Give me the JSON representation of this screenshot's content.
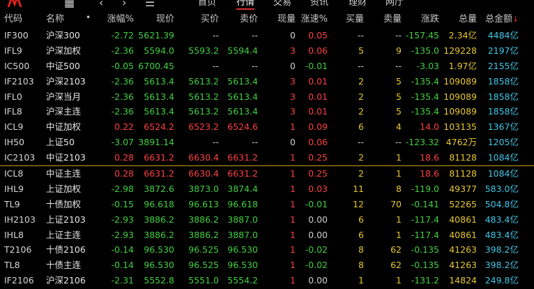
{
  "nav": {
    "items": [
      "首页",
      "行情",
      "交易",
      "资讯",
      "理财",
      "网厅"
    ],
    "active_index": 1
  },
  "headers": [
    "代码",
    "名称",
    "涨幅%",
    "现价",
    "买价",
    "卖价",
    "现量",
    "涨速%",
    "买量",
    "卖量",
    "涨跌",
    "总量",
    "总金额"
  ],
  "header_dot": "•",
  "sort_arrow": "↓",
  "colors": {
    "up": "#ff4040",
    "down": "#40d040",
    "neutral": "#d0d0d0",
    "volume": "#e8c830",
    "amount": "#40c8e8",
    "separator": "#c8a000"
  },
  "rows": [
    {
      "code": "IF300",
      "name": "沪深300",
      "chg": "-2.72",
      "price": "5621.39",
      "bid": "--",
      "ask": "--",
      "cur": "0",
      "spd": "0.05",
      "bv": "--",
      "av": "--",
      "diff": "-157.45",
      "vol": "2.34亿",
      "amt": "4484亿",
      "dir": "down",
      "cur_dir": "neutral",
      "spd_dir": "up",
      "price_dir": "down",
      "bid_dir": "neutral",
      "ask_dir": "neutral"
    },
    {
      "code": "IFL9",
      "name": "沪深加权",
      "chg": "-2.36",
      "price": "5594.0",
      "bid": "5593.2",
      "ask": "5594.4",
      "cur": "3",
      "spd": "0.06",
      "bv": "5",
      "av": "9",
      "diff": "-135.0",
      "vol": "129228",
      "amt": "2197亿",
      "dir": "down",
      "cur_dir": "up",
      "spd_dir": "up",
      "price_dir": "down",
      "bid_dir": "down",
      "ask_dir": "down"
    },
    {
      "code": "IC500",
      "name": "中证500",
      "chg": "-0.05",
      "price": "6700.45",
      "bid": "--",
      "ask": "--",
      "cur": "0",
      "spd": "-0.01",
      "bv": "--",
      "av": "--",
      "diff": "-3.03",
      "vol": "1.97亿",
      "amt": "2155亿",
      "dir": "down",
      "cur_dir": "neutral",
      "spd_dir": "down",
      "price_dir": "down",
      "bid_dir": "neutral",
      "ask_dir": "neutral"
    },
    {
      "code": "IF2103",
      "name": "沪深2103",
      "chg": "-2.36",
      "price": "5613.4",
      "bid": "5613.2",
      "ask": "5613.4",
      "cur": "3",
      "spd": "0.01",
      "bv": "2",
      "av": "5",
      "diff": "-135.4",
      "vol": "109089",
      "amt": "1858亿",
      "dir": "down",
      "cur_dir": "up",
      "spd_dir": "up",
      "price_dir": "down",
      "bid_dir": "down",
      "ask_dir": "down"
    },
    {
      "code": "IFL0",
      "name": "沪深当月",
      "chg": "-2.36",
      "price": "5613.4",
      "bid": "5613.2",
      "ask": "5613.4",
      "cur": "3",
      "spd": "0.01",
      "bv": "2",
      "av": "5",
      "diff": "-135.4",
      "vol": "109089",
      "amt": "1858亿",
      "dir": "down",
      "cur_dir": "up",
      "spd_dir": "up",
      "price_dir": "down",
      "bid_dir": "down",
      "ask_dir": "down"
    },
    {
      "code": "IFL8",
      "name": "沪深主连",
      "chg": "-2.36",
      "price": "5613.4",
      "bid": "5613.2",
      "ask": "5613.4",
      "cur": "3",
      "spd": "0.01",
      "bv": "2",
      "av": "5",
      "diff": "-135.4",
      "vol": "109089",
      "amt": "1858亿",
      "dir": "down",
      "cur_dir": "up",
      "spd_dir": "up",
      "price_dir": "down",
      "bid_dir": "down",
      "ask_dir": "down"
    },
    {
      "code": "ICL9",
      "name": "中证加权",
      "chg": "0.22",
      "price": "6524.2",
      "bid": "6523.2",
      "ask": "6524.6",
      "cur": "1",
      "spd": "0.09",
      "bv": "6",
      "av": "4",
      "diff": "14.0",
      "vol": "103135",
      "amt": "1367亿",
      "dir": "up",
      "cur_dir": "up",
      "spd_dir": "up",
      "price_dir": "up",
      "bid_dir": "up",
      "ask_dir": "up"
    },
    {
      "code": "IH50",
      "name": "上证50",
      "chg": "-3.07",
      "price": "3891.14",
      "bid": "--",
      "ask": "--",
      "cur": "0",
      "spd": "0.06",
      "bv": "--",
      "av": "--",
      "diff": "-123.32",
      "vol": "4762万",
      "amt": "1205亿",
      "dir": "down",
      "cur_dir": "neutral",
      "spd_dir": "up",
      "price_dir": "down",
      "bid_dir": "neutral",
      "ask_dir": "neutral"
    },
    {
      "code": "IC2103",
      "name": "中证2103",
      "chg": "0.28",
      "price": "6631.2",
      "bid": "6630.4",
      "ask": "6631.2",
      "cur": "1",
      "spd": "0.25",
      "bv": "2",
      "av": "1",
      "diff": "18.6",
      "vol": "81128",
      "amt": "1084亿",
      "dir": "up",
      "cur_dir": "up",
      "spd_dir": "up",
      "price_dir": "up",
      "bid_dir": "up",
      "ask_dir": "up"
    },
    {
      "code": "ICL8",
      "name": "中证主连",
      "chg": "0.28",
      "price": "6631.2",
      "bid": "6630.4",
      "ask": "6631.2",
      "cur": "1",
      "spd": "0.25",
      "bv": "2",
      "av": "1",
      "diff": "18.6",
      "vol": "81128",
      "amt": "1084亿",
      "dir": "up",
      "cur_dir": "up",
      "spd_dir": "up",
      "price_dir": "up",
      "bid_dir": "up",
      "ask_dir": "up"
    },
    {
      "code": "IHL9",
      "name": "上证加权",
      "chg": "-2.98",
      "price": "3872.6",
      "bid": "3873.0",
      "ask": "3874.4",
      "cur": "1",
      "spd": "0.03",
      "bv": "11",
      "av": "8",
      "diff": "-119.0",
      "vol": "49377",
      "amt": "583.0亿",
      "dir": "down",
      "cur_dir": "up",
      "spd_dir": "up",
      "price_dir": "down",
      "bid_dir": "down",
      "ask_dir": "down"
    },
    {
      "code": "TL9",
      "name": "十债加权",
      "chg": "-0.15",
      "price": "96.618",
      "bid": "96.613",
      "ask": "96.618",
      "cur": "1",
      "spd": "-0.01",
      "bv": "12",
      "av": "70",
      "diff": "-0.141",
      "vol": "52265",
      "amt": "504.8亿",
      "dir": "down",
      "cur_dir": "up",
      "spd_dir": "down",
      "price_dir": "down",
      "bid_dir": "down",
      "ask_dir": "down"
    },
    {
      "code": "IH2103",
      "name": "上证2103",
      "chg": "-2.93",
      "price": "3886.2",
      "bid": "3886.2",
      "ask": "3887.0",
      "cur": "1",
      "spd": "0.00",
      "bv": "6",
      "av": "1",
      "diff": "-117.4",
      "vol": "40861",
      "amt": "483.4亿",
      "dir": "down",
      "cur_dir": "up",
      "spd_dir": "neutral",
      "price_dir": "down",
      "bid_dir": "down",
      "ask_dir": "down"
    },
    {
      "code": "IHL8",
      "name": "上证主连",
      "chg": "-2.93",
      "price": "3886.2",
      "bid": "3886.2",
      "ask": "3887.0",
      "cur": "1",
      "spd": "0.00",
      "bv": "6",
      "av": "1",
      "diff": "-117.4",
      "vol": "40861",
      "amt": "483.4亿",
      "dir": "down",
      "cur_dir": "up",
      "spd_dir": "neutral",
      "price_dir": "down",
      "bid_dir": "down",
      "ask_dir": "down"
    },
    {
      "code": "T2106",
      "name": "十债2106",
      "chg": "-0.14",
      "price": "96.530",
      "bid": "96.525",
      "ask": "96.530",
      "cur": "1",
      "spd": "-0.02",
      "bv": "8",
      "av": "62",
      "diff": "-0.135",
      "vol": "41263",
      "amt": "398.2亿",
      "dir": "down",
      "cur_dir": "up",
      "spd_dir": "down",
      "price_dir": "down",
      "bid_dir": "down",
      "ask_dir": "down"
    },
    {
      "code": "TL8",
      "name": "十债主连",
      "chg": "-0.14",
      "price": "96.530",
      "bid": "96.525",
      "ask": "96.530",
      "cur": "1",
      "spd": "-0.02",
      "bv": "8",
      "av": "62",
      "diff": "-0.135",
      "vol": "41263",
      "amt": "398.2亿",
      "dir": "down",
      "cur_dir": "up",
      "spd_dir": "down",
      "price_dir": "down",
      "bid_dir": "down",
      "ask_dir": "down"
    },
    {
      "code": "IF2106",
      "name": "沪深2106",
      "chg": "-2.31",
      "price": "5552.8",
      "bid": "5551.0",
      "ask": "5554.2",
      "cur": "1",
      "spd": "0.00",
      "bv": "1",
      "av": "1",
      "diff": "-131.2",
      "vol": "14824",
      "amt": "249.8亿",
      "dir": "down",
      "cur_dir": "up",
      "spd_dir": "neutral",
      "price_dir": "down",
      "bid_dir": "down",
      "ask_dir": "down"
    }
  ]
}
